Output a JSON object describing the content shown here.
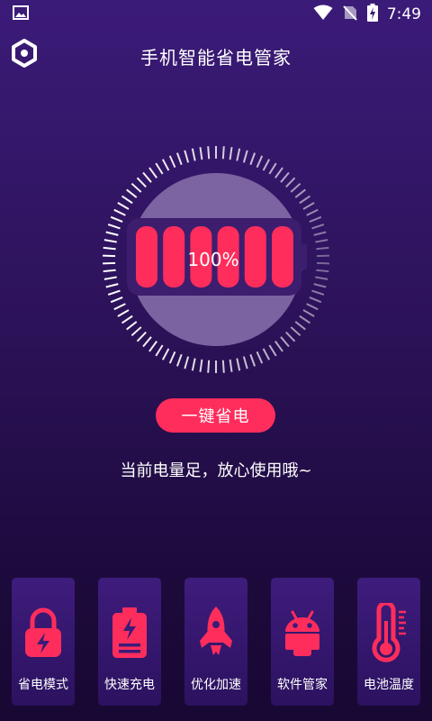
{
  "status_bar": {
    "time": "7:49",
    "icons": [
      "image-notification-icon",
      "wifi-icon",
      "no-sim-icon",
      "battery-charging-icon"
    ]
  },
  "header": {
    "title": "手机智能省电管家",
    "settings_icon": "settings-hex-icon"
  },
  "battery": {
    "level_text": "100%",
    "level": 1.0,
    "color": "#ff2d5c"
  },
  "action_button": {
    "label": "一键省电"
  },
  "status_message": "当前电量足，放心使用哦~",
  "features": [
    {
      "label": "省电模式",
      "icon": "lock-icon"
    },
    {
      "label": "快速充电",
      "icon": "charging-battery-icon"
    },
    {
      "label": "优化加速",
      "icon": "rocket-icon"
    },
    {
      "label": "软件管家",
      "icon": "android-icon"
    },
    {
      "label": "电池温度",
      "icon": "thermometer-icon"
    }
  ],
  "colors": {
    "accent": "#ff2d5c",
    "background_top": "#3b1b78",
    "background_bottom": "#180833"
  }
}
